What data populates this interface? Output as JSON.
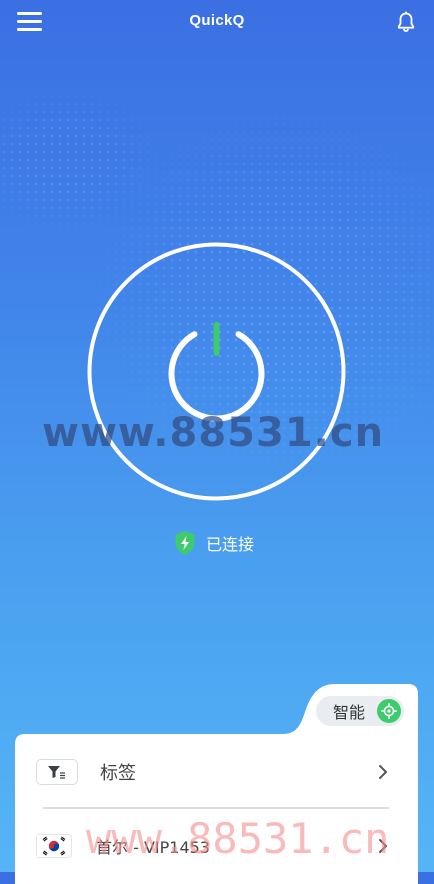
{
  "app": {
    "title": "QuickQ"
  },
  "connection": {
    "status_label": "已连接",
    "state": "connected"
  },
  "watermark": {
    "text_top": "www.88531.cn",
    "text_bottom": "www.88531.cn"
  },
  "panel": {
    "mode_label": "智能",
    "tag_label": "标签",
    "server_label": "首尔 - VIP1453"
  },
  "icons": {
    "menu": "hamburger-menu-icon",
    "notifications": "bell-icon",
    "power": "power-icon",
    "status": "shield-lightning-icon",
    "mode": "smart-mode-icon",
    "tag": "filter-list-icon",
    "flag": "south-korea-flag-icon",
    "chevron": "chevron-right-icon"
  },
  "colors": {
    "accent_green": "#3ecb6e",
    "background_top": "#3b6fe3",
    "background_bottom": "#55b5f6"
  }
}
